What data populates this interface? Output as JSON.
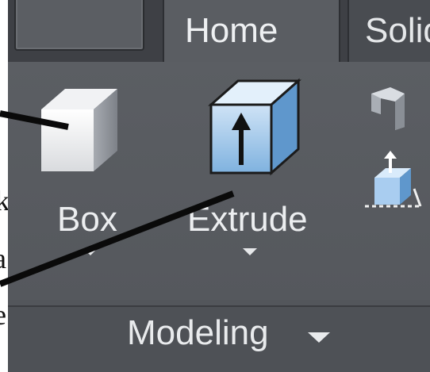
{
  "ribbon": {
    "tabs": [
      {
        "label": "Home"
      },
      {
        "label": "Solid"
      }
    ],
    "panel": {
      "title": "Modeling",
      "tools": [
        {
          "label": "Box",
          "icon": "box-icon"
        },
        {
          "label": "Extrude",
          "icon": "extrude-icon"
        }
      ],
      "small_tools": [
        {
          "icon": "polysolid-icon"
        },
        {
          "icon": "presspull-icon"
        }
      ]
    }
  },
  "margin_text": [
    {
      "text": "k"
    },
    {
      "text": "a"
    },
    {
      "text": "e"
    }
  ]
}
